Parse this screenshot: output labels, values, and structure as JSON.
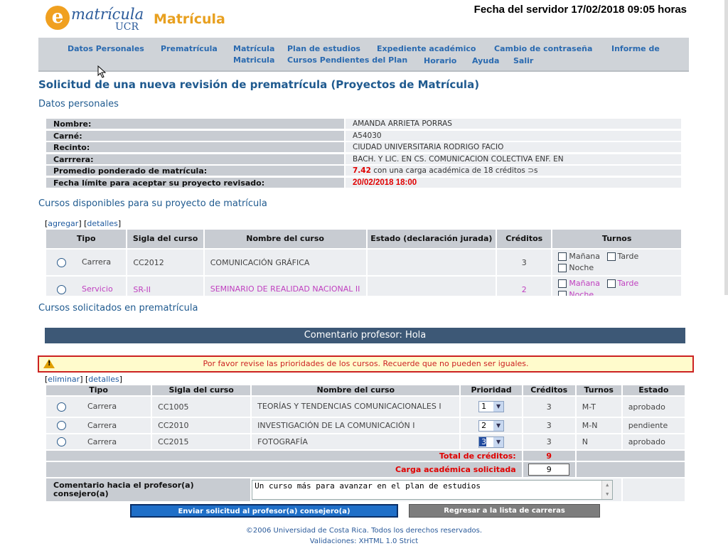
{
  "header": {
    "logo_e": "e",
    "logo_word": "matrícula",
    "logo_ucr": "UCR",
    "app_title": "Matrícula",
    "server_time": "Fecha del servidor 17/02/2018 09:05 horas"
  },
  "nav": {
    "items": [
      "Datos Personales",
      "Prematrícula",
      "Matrícula",
      "Plan de estudios",
      "Expediente académico",
      "Cambio de contraseña",
      "Informe de",
      "Matricula",
      "Cursos Pendientes del Plan",
      "Horario",
      "Ayuda",
      "Salir"
    ]
  },
  "page_title": "Solicitud de una nueva revisión de prematrícula (Proyectos de Matrícula)",
  "personal": {
    "heading": "Datos personales",
    "rows": [
      {
        "label": "Nombre:",
        "value": "AMANDA ARRIETA PORRAS"
      },
      {
        "label": "Carné:",
        "value": "A54030"
      },
      {
        "label": "Recinto:",
        "value": "CIUDAD UNIVERSITARIA RODRIGO FACIO"
      },
      {
        "label": "Carrrera:",
        "value": "BACH. Y LIC. EN CS. COMUNICACION COLECTIVA ENF. EN"
      },
      {
        "label": "Promedio ponderado de matrícula:",
        "value_num": "7.42",
        "value_rest": "con una carga académica de 18 créditos ⊃s"
      },
      {
        "label": "Fecha límite para aceptar su proyecto revisado:",
        "value": "20/02/2018 18:00"
      }
    ]
  },
  "available": {
    "heading": "Cursos disponibles para su proyecto de matrícula",
    "link_add": "agregar",
    "link_details": "detalles",
    "headers": [
      "Tipo",
      "Sigla del curso",
      "Nombre del curso",
      "Estado (declaración jurada)",
      "Créditos",
      "Turnos"
    ],
    "rows": [
      {
        "tipo": "Carrera",
        "sigla": "CC2012",
        "nombre": "COMUNICACIÓN GRÁFICA",
        "estado": "",
        "creditos": "3",
        "turnos": [
          "Mañana",
          "Tarde",
          "Noche"
        ]
      },
      {
        "tipo": "Servicio",
        "sigla": "SR-II",
        "nombre": "SEMINARIO DE REALIDAD NACIONAL II",
        "estado": "",
        "creditos": "2",
        "turnos": [
          "Mañana",
          "Tarde",
          "Noche"
        ]
      }
    ]
  },
  "requested": {
    "heading": "Cursos solicitados en prematrícula",
    "comment_bar": "Comentario profesor: Hola",
    "warning": "Por favor revise las prioridades de los cursos. Recuerde que no pueden ser iguales.",
    "link_delete": "eliminar",
    "link_details": "detalles",
    "headers": [
      "Tipo",
      "Sigla del curso",
      "Nombre del curso",
      "Prioridad",
      "Créditos",
      "Turnos",
      "Estado"
    ],
    "rows": [
      {
        "tipo": "Carrera",
        "sigla": "CC1005",
        "nombre": "TEORÍAS Y TENDENCIAS COMUNICACIONALES I",
        "prioridad": "1",
        "creditos": "3",
        "turnos": "M-T",
        "estado": "aprobado"
      },
      {
        "tipo": "Carrera",
        "sigla": "CC2010",
        "nombre": "INVESTIGACIÓN DE LA COMUNICACIÓN I",
        "prioridad": "2",
        "creditos": "3",
        "turnos": "M-N",
        "estado": "pendiente"
      },
      {
        "tipo": "Carrera",
        "sigla": "CC2015",
        "nombre": "FOTOGRAFÍA",
        "prioridad": "3",
        "creditos": "3",
        "turnos": "N",
        "estado": "aprobado"
      }
    ],
    "total_label": "Total de créditos:",
    "total_value": "9",
    "load_label": "Carga académica solicitada",
    "load_value": "9",
    "comment_label": "Comentario hacia el profesor(a) consejero(a)",
    "comment_value": "Un curso más para avanzar en el plan de estudios"
  },
  "buttons": {
    "send": "Enviar solicitud al profesor(a) consejero(a)",
    "back": "Regresar a la lista de carreras"
  },
  "footer": {
    "copyright": "©2006 Universidad de Costa Rica. Todos los derechos reservados.",
    "validation": "Validaciones: XHTML 1.0 Strict"
  }
}
